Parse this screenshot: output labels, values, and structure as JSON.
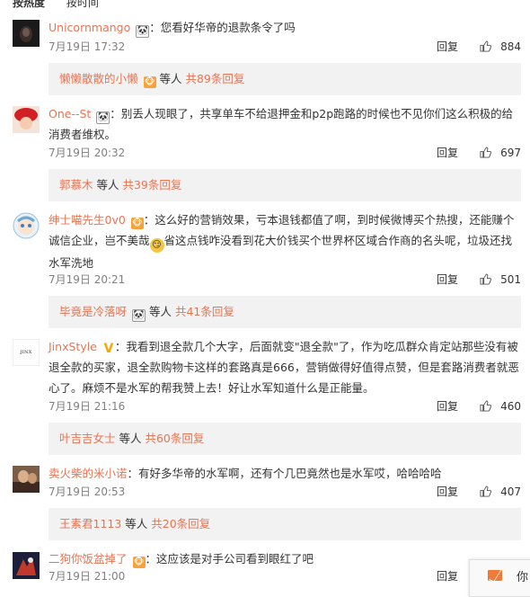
{
  "sort": {
    "hot": "按热度",
    "time": "按时间"
  },
  "comments": [
    {
      "user": "Unicornmango",
      "badge": "🐼",
      "sep": "：",
      "text": "您看好华帝的退款条令了吗",
      "time": "7月19日 17:32",
      "reply": "回复",
      "likes": "884",
      "reply_box": {
        "name": "懒懒散散的小懒",
        "name_badge": "🐵",
        "mid": " 等人 ",
        "count": "共89条回复"
      }
    },
    {
      "user": "One--St",
      "badge": "🐼",
      "sep": "：",
      "text": "别丢人现眼了，共享单车不给退押金和p2p跑路的时候也不见你们这么积极的给消费者维权。",
      "time": "7月19日 20:32",
      "reply": "回复",
      "likes": "697",
      "reply_box": {
        "name": "郭慕木",
        "mid": " 等人 ",
        "count": "共39条回复"
      }
    },
    {
      "user": "绅士喵先生0v0",
      "badge": "🐵",
      "sep": "：",
      "text_a": "这么好的营销效果，亏本退钱都值了啊，到时候微博买个热搜，还能赚个诚信企业，岂不美哉",
      "emoji": "😏",
      "text_b": "省这点钱咋没看到花大价钱买个世界杯区域合作商的名头呢，垃圾还找水军洗地",
      "time": "7月19日 20:21",
      "reply": "回复",
      "likes": "501",
      "reply_box": {
        "name": "毕竟是冷落呀",
        "name_badge": "🐼",
        "mid": " 等人 ",
        "count": "共41条回复"
      }
    },
    {
      "user": "JinxStyle",
      "badge": "V",
      "sep": "：",
      "avatar_text": "JINX STYLE",
      "text": "我看到退全款几个大字，后面就变\"退全款\"了，作为吃瓜群众肯定站那些没有被退全款的买家，退全款购物卡这样的套路真是666，营销做得好值得点赞，但是套路消费者就恶心了。麻烦不是水军的帮我赞上去！好让水军知道什么是正能量。",
      "time": "7月19日 21:16",
      "reply": "回复",
      "likes": "460",
      "reply_box": {
        "name": "叶吉吉女士",
        "mid": " 等人 ",
        "count": "共60条回复"
      }
    },
    {
      "user": "卖火柴的米小诺",
      "sep": "：",
      "text": "有好多华帝的水军啊，还有个几巴竟然也是水军哎，哈哈哈哈",
      "time": "7月19日 20:53",
      "reply": "回复",
      "likes": "407",
      "reply_box": {
        "name": "王素君1113",
        "mid": " 等人 ",
        "count": "共20条回复"
      }
    },
    {
      "user": "二狗你饭盆掉了",
      "badge": "🐵",
      "sep": "：",
      "text": "这应该是对手公司看到眼红了吧",
      "time": "7月19日 21:00",
      "reply": "回复"
    }
  ],
  "float_label": "你",
  "colors": {
    "username": "#eb7350",
    "reply_bg": "#f2f2f2",
    "meta": "#808080"
  }
}
